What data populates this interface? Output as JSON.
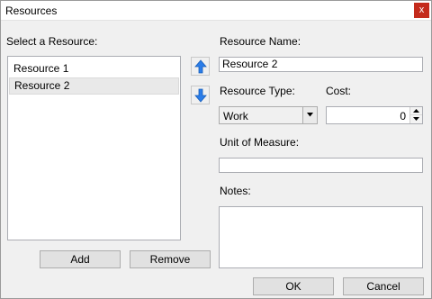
{
  "window": {
    "title": "Resources",
    "close_glyph": "x"
  },
  "left": {
    "list_label": "Select a Resource:",
    "items": [
      {
        "label": "Resource 1",
        "selected": false
      },
      {
        "label": "Resource 2",
        "selected": true
      }
    ],
    "add_label": "Add",
    "remove_label": "Remove"
  },
  "order": {
    "up_icon": "move-up-arrow-icon",
    "down_icon": "move-down-arrow-icon",
    "arrow_color": "#2b7de9"
  },
  "form": {
    "name_label": "Resource Name:",
    "name_value": "Resource 2",
    "type_label": "Resource Type:",
    "type_value": "Work",
    "cost_label": "Cost:",
    "cost_value": "0",
    "unit_label": "Unit of Measure:",
    "unit_value": "",
    "notes_label": "Notes:",
    "notes_value": ""
  },
  "footer": {
    "ok_label": "OK",
    "cancel_label": "Cancel"
  }
}
